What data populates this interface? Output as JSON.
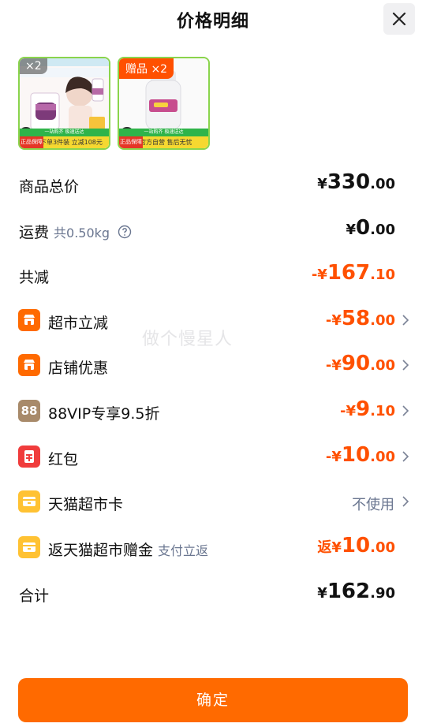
{
  "header": {
    "title": "价格明细"
  },
  "thumbnails": [
    {
      "badge": "×2",
      "bottom_text": "下单3件装 立减108元",
      "guarantee": "正品保障",
      "stripe": "一站购齐 极速送达"
    },
    {
      "badge": "赠品 ×2",
      "bottom_text": "官方自营 售后无忧",
      "guarantee": "正品保障",
      "stripe": "一站购齐 极速送达"
    }
  ],
  "rows": {
    "total": {
      "label": "商品总价",
      "symbol": "¥",
      "int": "330",
      "dec": ".00"
    },
    "shipping": {
      "label": "运费",
      "sub": "共0.50kg",
      "symbol": "¥",
      "int": "0",
      "dec": ".00"
    },
    "discount_total": {
      "label": "共减",
      "symbol": "-¥",
      "int": "167",
      "dec": ".10"
    },
    "supermarket_off": {
      "label": "超市立减",
      "symbol": "-¥",
      "int": "58",
      "dec": ".00"
    },
    "store_promo": {
      "label": "店铺优惠",
      "symbol": "-¥",
      "int": "90",
      "dec": ".00"
    },
    "vip": {
      "icon_text": "88",
      "label": "88VIP专享9.5折",
      "symbol": "-¥",
      "int": "9",
      "dec": ".10"
    },
    "red_packet": {
      "label": "红包",
      "symbol": "-¥",
      "int": "10",
      "dec": ".00"
    },
    "tmall_card": {
      "label": "天猫超市卡",
      "value": "不使用"
    },
    "gift_money": {
      "label": "返天猫超市赠金",
      "sub": "支付立返",
      "symbol": "返¥",
      "int": "10",
      "dec": ".00"
    },
    "sum": {
      "label": "合计",
      "symbol": "¥",
      "int": "162",
      "dec": ".90"
    }
  },
  "confirm_button": {
    "label": "确定"
  },
  "watermark": "做个慢星人",
  "colors": {
    "accent": "#ff5000",
    "button": "#ff6a00"
  }
}
